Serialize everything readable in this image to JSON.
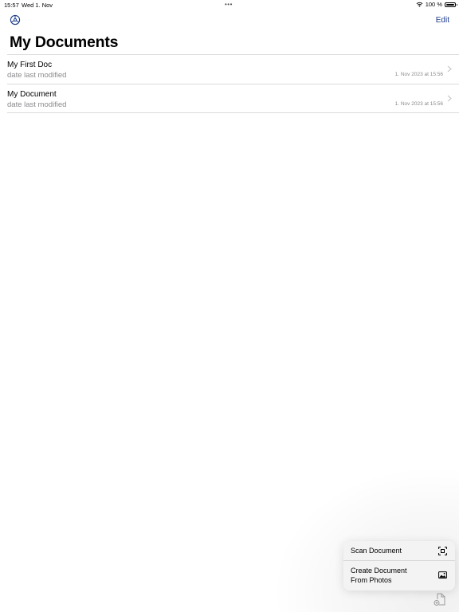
{
  "status_bar": {
    "time": "15:57",
    "date": "Wed 1. Nov",
    "battery": "100 %",
    "battery_level": 1.0
  },
  "nav": {
    "edit_label": "Edit",
    "settings_icon": "gear-icon"
  },
  "page": {
    "title": "My Documents"
  },
  "documents": [
    {
      "title": "My First Doc",
      "subtitle": "date last modified",
      "date": "1. Nov 2023 at 15:56"
    },
    {
      "title": "My Document",
      "subtitle": "date last modified",
      "date": "1. Nov 2023 at 15:56"
    }
  ],
  "menu": {
    "items": [
      {
        "label": "Scan Document",
        "icon": "scan-icon"
      },
      {
        "label": "Create Document From Photos",
        "icon": "photo-icon"
      }
    ]
  },
  "colors": {
    "accent": "#1a3b8c",
    "secondary_text": "#8a8a8e",
    "separator": "#dcdcdc"
  }
}
